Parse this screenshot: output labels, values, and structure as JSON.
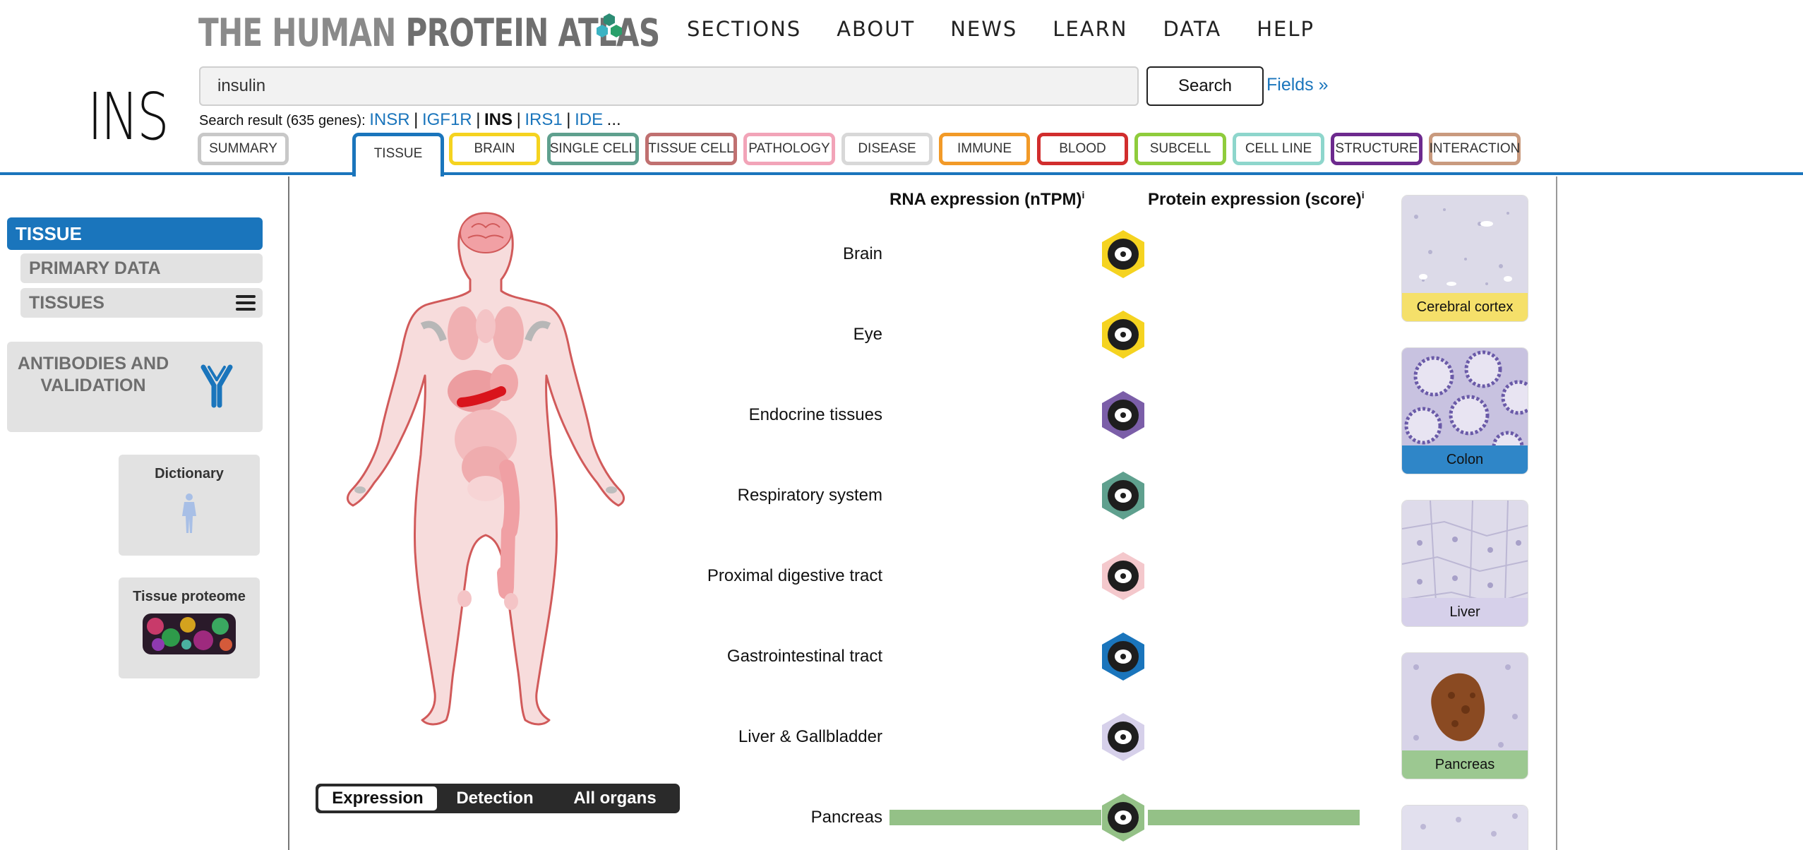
{
  "header": {
    "logo_the": "THE HUMAN ",
    "logo_protein": "PROTEIN ATLAS",
    "nav": [
      "SECTIONS",
      "ABOUT",
      "NEWS",
      "LEARN",
      "DATA",
      "HELP"
    ],
    "gene": "INS",
    "search_value": "insulin",
    "search_button": "Search",
    "fields_link": "Fields »",
    "result_prefix": "Search result (635 genes):",
    "result_genes": [
      "INSR",
      "IGF1R",
      "INS",
      "IRS1",
      "IDE"
    ],
    "result_more": "..."
  },
  "tabs": [
    "SUMMARY",
    "TISSUE",
    "BRAIN",
    "SINGLE CELL",
    "TISSUE CELL",
    "PATHOLOGY",
    "DISEASE",
    "IMMUNE",
    "BLOOD",
    "SUBCELL",
    "CELL LINE",
    "STRUCTURE",
    "INTERACTION"
  ],
  "tab_colors": [
    "#c8c8c8",
    "#1a75bc",
    "#f5d320",
    "#5fa08e",
    "#c07070",
    "#f2a4b8",
    "#d8d8d8",
    "#f29a28",
    "#d12d2d",
    "#8fcc3c",
    "#8ed6cc",
    "#6d2a8e",
    "#c99a7e"
  ],
  "sidebar": {
    "tissue": "TISSUE",
    "primary_data": "PRIMARY DATA",
    "tissues": "TISSUES",
    "antibodies": "ANTIBODIES AND VALIDATION",
    "dictionary": "Dictionary",
    "tissue_proteome": "Tissue proteome"
  },
  "table": {
    "rna_header": "RNA expression (nTPM)",
    "protein_header": "Protein expression (score)",
    "info_mark": "i",
    "organs": [
      {
        "name": "Brain",
        "color": "#f5d320",
        "icon": "brain-icon",
        "rna": 0,
        "protein": 0
      },
      {
        "name": "Eye",
        "color": "#f5d320",
        "icon": "eye-icon",
        "rna": 0,
        "protein": 0
      },
      {
        "name": "Endocrine tissues",
        "color": "#7b5ea8",
        "icon": "thyroid-icon",
        "rna": 0,
        "protein": 0
      },
      {
        "name": "Respiratory system",
        "color": "#5fa08e",
        "icon": "lungs-icon",
        "rna": 0,
        "protein": 0
      },
      {
        "name": "Proximal digestive tract",
        "color": "#f4c8cc",
        "icon": "head-icon",
        "rna": 0,
        "protein": 0
      },
      {
        "name": "Gastrointestinal tract",
        "color": "#1a75bc",
        "icon": "stomach-icon",
        "rna": 0,
        "protein": 0
      },
      {
        "name": "Liver & Gallbladder",
        "color": "#d6d0ea",
        "icon": "liver-icon",
        "rna": 0,
        "protein": 0
      },
      {
        "name": "Pancreas",
        "color": "#94c187",
        "icon": "pancreas-icon",
        "rna": 1,
        "protein": 1
      }
    ]
  },
  "toggle": [
    "Expression",
    "Detection",
    "All organs"
  ],
  "thumbnails": [
    {
      "caption": "Cerebral cortex",
      "color": "#f5e06a"
    },
    {
      "caption": "Colon",
      "color": "#2f86c8"
    },
    {
      "caption": "Liver",
      "color": "#d6d0ea"
    },
    {
      "caption": "Pancreas",
      "color": "#9cc891"
    }
  ]
}
